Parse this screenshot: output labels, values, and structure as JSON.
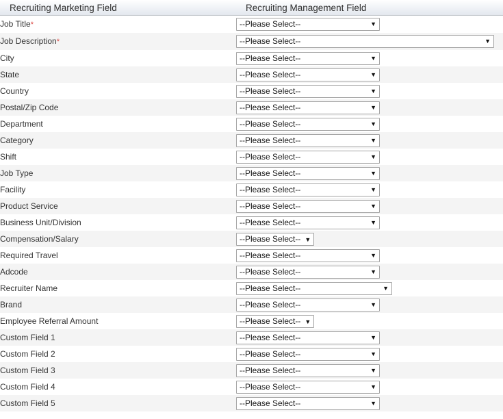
{
  "table": {
    "headers": {
      "left": "Recruiting Marketing Field",
      "right": "Recruiting Management Field"
    },
    "select_placeholder": "--Please Select--",
    "dropdown_arrow": "▼",
    "required_marker": "*",
    "colors": {
      "header_gradient_top": "#ffffff",
      "header_gradient_bottom": "#e3e7ee",
      "header_border": "#c3c7cc",
      "row_alt_background": "#f4f4f4",
      "row_background": "#ffffff",
      "label_text": "#333333",
      "required_asterisk": "#d9443f",
      "select_border": "#a3a3a3"
    },
    "rows": [
      {
        "label": "Job Title",
        "required": true,
        "value": "--Please Select--",
        "width": "std"
      },
      {
        "label": "Job Description",
        "required": true,
        "value": "--Please Select--",
        "width": "wide"
      },
      {
        "label": "City",
        "required": false,
        "value": "--Please Select--",
        "width": "std"
      },
      {
        "label": "State",
        "required": false,
        "value": "--Please Select--",
        "width": "std"
      },
      {
        "label": "Country",
        "required": false,
        "value": "--Please Select--",
        "width": "std"
      },
      {
        "label": "Postal/Zip Code",
        "required": false,
        "value": "--Please Select--",
        "width": "std"
      },
      {
        "label": "Department",
        "required": false,
        "value": "--Please Select--",
        "width": "std"
      },
      {
        "label": "Category",
        "required": false,
        "value": "--Please Select--",
        "width": "std"
      },
      {
        "label": "Shift",
        "required": false,
        "value": "--Please Select--",
        "width": "std"
      },
      {
        "label": "Job Type",
        "required": false,
        "value": "--Please Select--",
        "width": "std"
      },
      {
        "label": "Facility",
        "required": false,
        "value": "--Please Select--",
        "width": "std"
      },
      {
        "label": "Product Service",
        "required": false,
        "value": "--Please Select--",
        "width": "std"
      },
      {
        "label": "Business Unit/Division",
        "required": false,
        "value": "--Please Select--",
        "width": "std"
      },
      {
        "label": "Compensation/Salary",
        "required": false,
        "value": "--Please Select--",
        "width": "narrow"
      },
      {
        "label": "Required Travel",
        "required": false,
        "value": "--Please Select--",
        "width": "std"
      },
      {
        "label": "Adcode",
        "required": false,
        "value": "--Please Select--",
        "width": "std"
      },
      {
        "label": "Recruiter Name",
        "required": false,
        "value": "--Please Select--",
        "width": "mid"
      },
      {
        "label": "Brand",
        "required": false,
        "value": "--Please Select--",
        "width": "std"
      },
      {
        "label": "Employee Referral Amount",
        "required": false,
        "value": "--Please Select--",
        "width": "narrow"
      },
      {
        "label": "Custom Field 1",
        "required": false,
        "value": "--Please Select--",
        "width": "std"
      },
      {
        "label": "Custom Field 2",
        "required": false,
        "value": "--Please Select--",
        "width": "std"
      },
      {
        "label": "Custom Field 3",
        "required": false,
        "value": "--Please Select--",
        "width": "std"
      },
      {
        "label": "Custom Field 4",
        "required": false,
        "value": "--Please Select--",
        "width": "std"
      },
      {
        "label": "Custom Field 5",
        "required": false,
        "value": "--Please Select--",
        "width": "std"
      }
    ]
  }
}
